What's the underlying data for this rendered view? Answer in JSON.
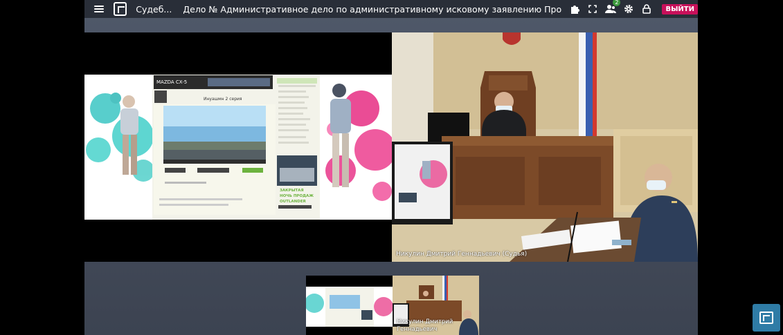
{
  "topbar": {
    "app_name": "Судеб...",
    "case_title": "Дело № Административное дело по административному исковому заявлению Прокурора Колпинског...",
    "participants_count": "2",
    "exit_label": "ВЫЙТИ"
  },
  "main": {
    "right_speaker_name": "Никулин Дмитрий Геннадьевич (Судья)"
  },
  "shared_screen": {
    "ad_banner": "MAZDA CX-5",
    "video_title": "Инуашмн 2 серия",
    "side_ad_text_1": "ЗАКРЫТАЯ",
    "side_ad_text_2": "НОЧЬ ПРОДАЖ",
    "side_ad_text_3": "OUTLANDER"
  },
  "thumbnails": {
    "judge_name_line1": "Никулин Дмитрий",
    "judge_name_line2": "Геннадьевич"
  },
  "colors": {
    "exit": "#c8105a",
    "badge": "#3c9a3c",
    "fab": "#2f7ca6"
  }
}
